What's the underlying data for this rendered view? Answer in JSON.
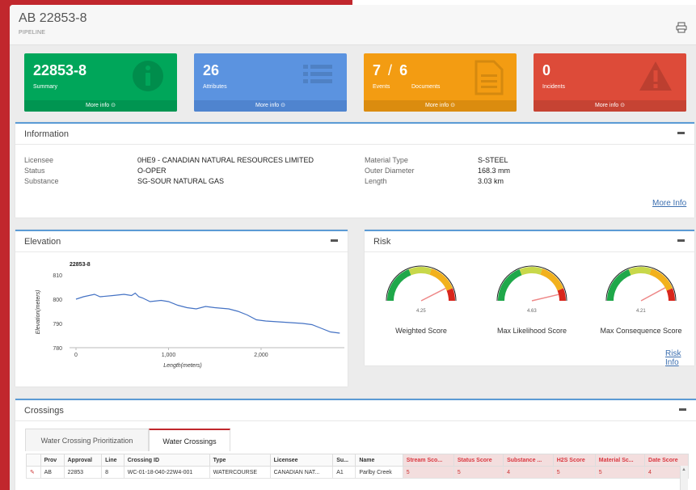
{
  "header": {
    "title": "AB 22853-8",
    "subtitle": "PIPELINE"
  },
  "colors": {
    "green": "#00a65a",
    "blue": "#5b93e0",
    "orange": "#f39c12",
    "red": "#dd4b39",
    "accent": "#5b9bd5"
  },
  "boxes": [
    {
      "value": "22853-8",
      "label": "Summary",
      "more": "More info ⊙",
      "icon": "info-icon"
    },
    {
      "value": "26",
      "label": "Attributes",
      "more": "More info ⊙",
      "icon": "list-icon"
    },
    {
      "value": "7",
      "sep": "/",
      "value2": "6",
      "label": "Events",
      "label2": "Documents",
      "more": "More info ⊙",
      "icon": "document-icon"
    },
    {
      "value": "0",
      "label": "Incidents",
      "more": "More info ⊙",
      "icon": "warning-icon"
    }
  ],
  "information": {
    "title": "Information",
    "left": [
      {
        "key": "Licensee",
        "value": "0HE9 - CANADIAN NATURAL RESOURCES LIMITED"
      },
      {
        "key": "Status",
        "value": "O-OPER"
      },
      {
        "key": "Substance",
        "value": "SG-SOUR NATURAL GAS"
      }
    ],
    "right": [
      {
        "key": "Material Type",
        "value": "S-STEEL"
      },
      {
        "key": "Outer Diameter",
        "value": "168.3 mm"
      },
      {
        "key": "Length",
        "value": "3.03 km"
      }
    ],
    "more_info": "More Info"
  },
  "elevation": {
    "title": "Elevation"
  },
  "chart_data": {
    "type": "line",
    "title": "22853-8",
    "xlabel": "Length(meters)",
    "ylabel": "Elevation(meters)",
    "xlim": [
      0,
      2900
    ],
    "ylim": [
      780,
      812
    ],
    "xticks": [
      "0",
      "1,000",
      "2,000"
    ],
    "yticks": [
      "810",
      "800",
      "790",
      "780"
    ],
    "series": [
      {
        "x": [
          0,
          80,
          200,
          260,
          400,
          520,
          600,
          640,
          680,
          720,
          800,
          920,
          1000,
          1100,
          1200,
          1300,
          1400,
          1500,
          1650,
          1750,
          1850,
          1950,
          2050,
          2250,
          2450,
          2550,
          2650,
          2750,
          2850
        ],
        "values": [
          800,
          801,
          802,
          801,
          801.5,
          802,
          801.5,
          802.5,
          801,
          800.5,
          799,
          799.5,
          799,
          797.5,
          796.5,
          796,
          797,
          796.5,
          796,
          795,
          793.5,
          791.5,
          791,
          790.5,
          790,
          789.5,
          788,
          786.5,
          786
        ]
      }
    ],
    "grid": false,
    "legend": "none"
  },
  "risk": {
    "title": "Risk",
    "gauges": [
      {
        "score": "4.25",
        "value": 4.25,
        "label": "Weighted Score"
      },
      {
        "score": "4.63",
        "value": 4.63,
        "label": "Max Likelihood Score"
      },
      {
        "score": "4.21",
        "value": 4.21,
        "label": "Max Consequence Score"
      }
    ],
    "info_link": "Risk Info"
  },
  "crossings": {
    "title": "Crossings",
    "tabs": [
      "Water Crossing Prioritization",
      "Water Crossings"
    ],
    "active_tab": "Water Crossings",
    "columns": [
      "",
      "Prov",
      "Approval",
      "Line",
      "Crossing ID",
      "Type",
      "Licensee",
      "Su...",
      "Name",
      "Stream Sco...",
      "Status Score",
      "Substance ...",
      "H2S Score",
      "Material Sc...",
      "Date Score"
    ],
    "rows": [
      [
        "✎",
        "AB",
        "22853",
        "8",
        "WC-01-18-040-22W4-001",
        "WATERCOURSE",
        "CANADIAN NAT...",
        "A1",
        "Parlby Creek",
        "5",
        "5",
        "4",
        "5",
        "5",
        "4"
      ]
    ]
  }
}
